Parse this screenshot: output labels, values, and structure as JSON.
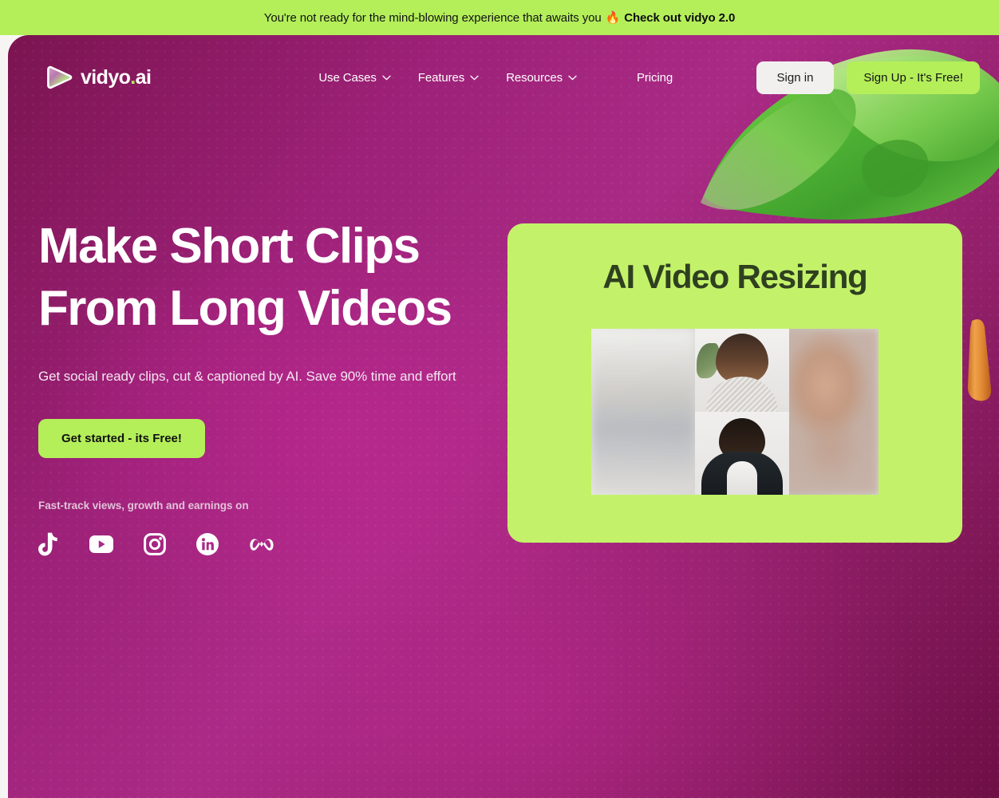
{
  "announcement": {
    "text": "You're not ready for the mind-blowing experience that awaits you",
    "flame_icon": "fire-emoji",
    "link_label": "Check out vidyo 2.0",
    "bg_color": "#b4ef5a"
  },
  "nav": {
    "logo_text": "vidyo",
    "logo_dot": ".",
    "logo_suffix": "ai",
    "links": [
      {
        "label": "Use Cases",
        "has_dropdown": true
      },
      {
        "label": "Features",
        "has_dropdown": true
      },
      {
        "label": "Resources",
        "has_dropdown": true
      },
      {
        "label": "Pricing",
        "has_dropdown": false
      }
    ],
    "sign_in_label": "Sign in",
    "sign_up_label": "Sign Up - It's Free!"
  },
  "hero": {
    "title_line1": "Make Short Clips",
    "title_line2": "From Long Videos",
    "subtitle": "Get social ready clips, cut & captioned by AI. Save 90% time and effort",
    "cta_label": "Get started - its Free!",
    "social_label": "Fast-track views, growth and earnings on",
    "social_icons": [
      "tiktok-icon",
      "youtube-icon",
      "instagram-icon",
      "linkedin-icon",
      "meta-icon"
    ]
  },
  "feature_card": {
    "title": "AI Video Resizing",
    "bg_color": "#c3f26a",
    "media": "video-resize-preview-thumbnail"
  },
  "colors": {
    "accent_green": "#b4ef5a",
    "card_green": "#c3f26a",
    "hero_magenta": "#9d2178",
    "hero_dark": "#6e0f46",
    "page_bg": "#f7f5f3",
    "decor_orange": "#e08a34"
  }
}
